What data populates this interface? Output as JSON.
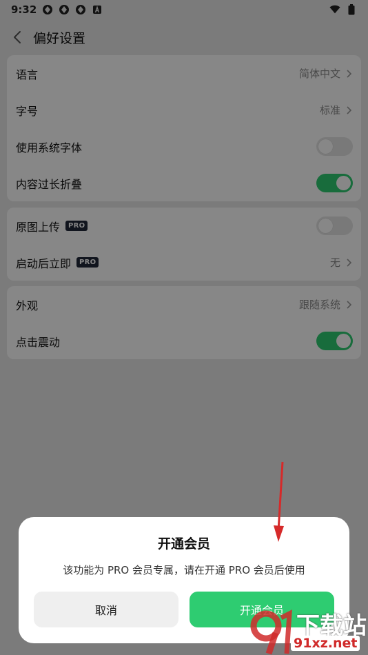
{
  "status_bar": {
    "time": "9:32",
    "icons": [
      "app-icon-1",
      "app-icon-2",
      "app-icon-3",
      "app-icon-a",
      "wifi-icon",
      "battery-icon"
    ]
  },
  "header": {
    "title": "偏好设置"
  },
  "group1": {
    "language": {
      "label": "语言",
      "value": "简体中文"
    },
    "font_size": {
      "label": "字号",
      "value": "标准"
    },
    "system_font": {
      "label": "使用系统字体",
      "on": false
    },
    "collapse_long": {
      "label": "内容过长折叠",
      "on": true
    }
  },
  "group2": {
    "original_upload": {
      "label": "原图上传",
      "badge": "PRO",
      "on": false
    },
    "launch_after": {
      "label": "启动后立即",
      "badge": "PRO",
      "value": "无"
    }
  },
  "group3": {
    "appearance": {
      "label": "外观",
      "value": "跟随系统"
    },
    "tap_vibrate": {
      "label": "点击震动",
      "on": true
    }
  },
  "dialog": {
    "title": "开通会员",
    "message": "该功能为 PRO 会员专属，请在开通 PRO 会员后使用",
    "cancel_label": "取消",
    "confirm_label": "开通会员"
  },
  "watermark": {
    "text": "下载站",
    "url": "91xz.net"
  },
  "colors": {
    "accent": "#2ecc71",
    "pro_badge": "#21283a",
    "arrow": "#d62a2a"
  }
}
